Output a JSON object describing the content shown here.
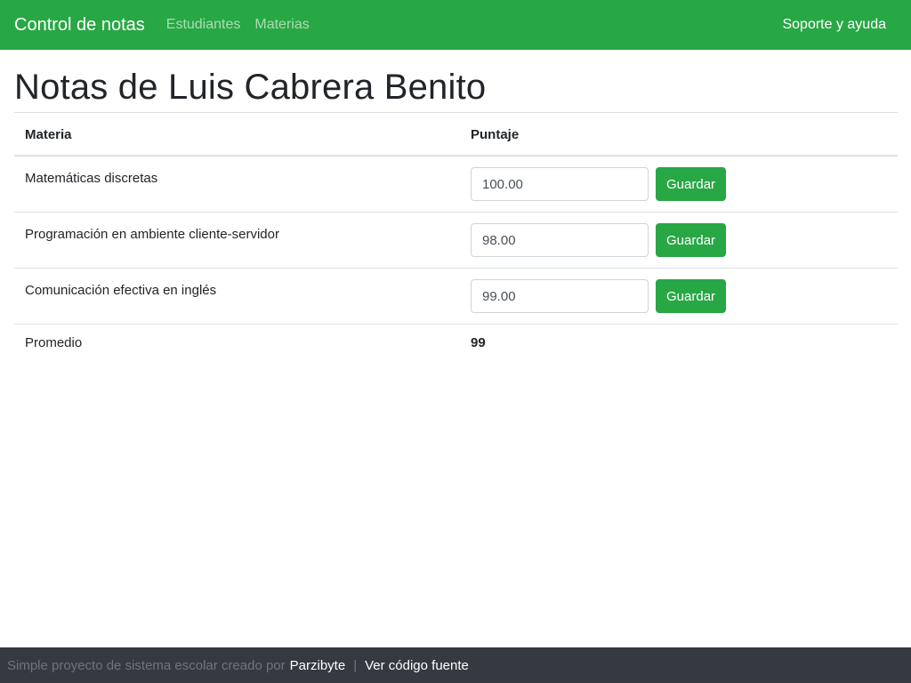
{
  "navbar": {
    "brand": "Control de notas",
    "links": [
      "Estudiantes",
      "Materias"
    ],
    "right_link": "Soporte y ayuda"
  },
  "page": {
    "title": "Notas de Luis Cabrera Benito"
  },
  "table": {
    "headers": [
      "Materia",
      "Puntaje"
    ],
    "rows": [
      {
        "subject": "Matemáticas discretas",
        "score": "100.00",
        "button": "Guardar"
      },
      {
        "subject": "Programación en ambiente cliente-servidor",
        "score": "98.00",
        "button": "Guardar"
      },
      {
        "subject": "Comunicación efectiva en inglés",
        "score": "99.00",
        "button": "Guardar"
      }
    ],
    "average_label": "Promedio",
    "average_value": "99"
  },
  "footer": {
    "text": "Simple proyecto de sistema escolar creado por",
    "author_link": "Parzibyte",
    "separator": "|",
    "source_link": "Ver código fuente"
  },
  "colors": {
    "navbar_bg": "#28a745",
    "button_bg": "#28a745",
    "footer_bg": "#343a40"
  }
}
